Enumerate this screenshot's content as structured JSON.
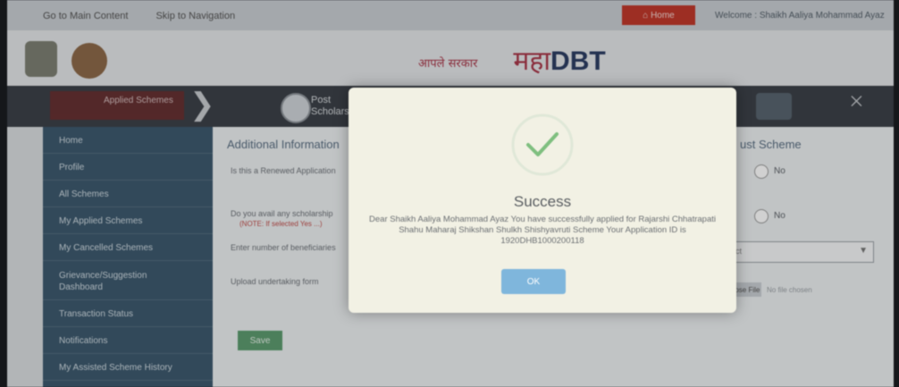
{
  "topbar": {
    "link_1": "Go to Main Content",
    "link_2": "Skip to Navigation",
    "home_label": "Home",
    "welcome_text": "Welcome : Shaikh Aaliya Mohammad Ayaz"
  },
  "header": {
    "logo_small": "आपले सरकार",
    "logo_main": "महा",
    "logo_dbt": "DBT"
  },
  "steps": {
    "step1_label": "Applied Schemes",
    "step2_label_line1": "Post",
    "step2_label_line2": "Scholarship"
  },
  "sidebar": {
    "items": [
      {
        "label": "Home"
      },
      {
        "label": "Profile"
      },
      {
        "label": "All Schemes"
      },
      {
        "label": "My Applied Schemes"
      },
      {
        "label": "My Cancelled Schemes"
      },
      {
        "label": "Grievance/Suggestion"
      },
      {
        "label": "Transaction Status"
      },
      {
        "label": "Notifications"
      },
      {
        "label": "My Assisted Scheme History"
      }
    ],
    "tall_label_line2": "Dashboard"
  },
  "main": {
    "title_left": "Additional Information",
    "title_right": "ust Scheme",
    "field_1": "Is this a Renewed Application",
    "field_2": "Do you avail any scholarship",
    "field_2_red": "(NOTE: If selected Yes ...)",
    "field_3": "Enter number of beneficiaries",
    "field_4": "Upload undertaking form",
    "radio_no": "No",
    "select_placeholder": "Select",
    "choose_file": "Choose File",
    "no_file": "No file chosen",
    "save_label": "Save"
  },
  "modal": {
    "title": "Success",
    "message": "Dear Shaikh Aaliya Mohammad Ayaz You have successfully applied for Rajarshi Chhatrapati Shahu Maharaj Shikshan Shulkh Shishyavruti Scheme Your Application ID is 1920DHB1000200118",
    "ok_label": "OK",
    "check_color": "#7fbf7f"
  }
}
